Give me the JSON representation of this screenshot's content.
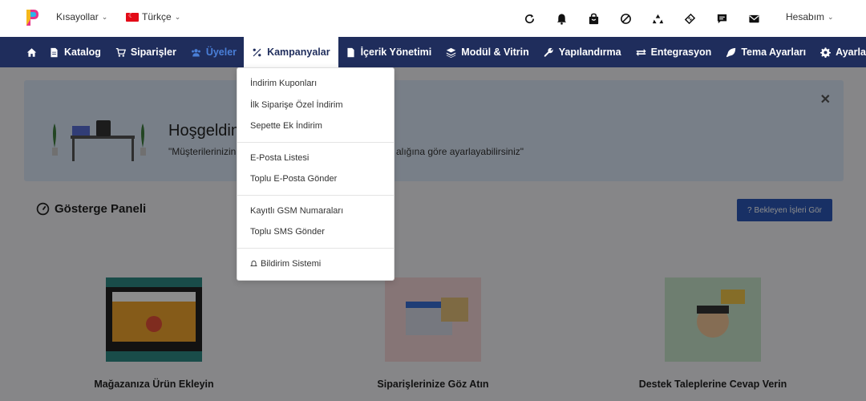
{
  "topbar": {
    "shortcuts_label": "Kısayollar",
    "language_label": "Türkçe",
    "account_label": "Hesabım",
    "icons": [
      "refresh-icon",
      "bell-icon",
      "shopping-bag-icon",
      "block-icon",
      "recycle-icon",
      "ticket-icon",
      "chat-icon",
      "mail-icon"
    ]
  },
  "nav": {
    "items": [
      {
        "label": "",
        "icon": "home-icon"
      },
      {
        "label": "Katalog",
        "icon": "file-icon"
      },
      {
        "label": "Siparişler",
        "icon": "cart-icon"
      },
      {
        "label": "Üyeler",
        "icon": "users-icon"
      },
      {
        "label": "Kampanyalar",
        "icon": "percent-icon"
      },
      {
        "label": "İçerik Yönetimi",
        "icon": "page-icon"
      },
      {
        "label": "Modül & Vitrin",
        "icon": "layers-icon"
      },
      {
        "label": "Yapılandırma",
        "icon": "wrench-icon"
      },
      {
        "label": "Entegrasyon",
        "icon": "exchange-icon"
      },
      {
        "label": "Tema Ayarları",
        "icon": "leaf-icon"
      },
      {
        "label": "Ayarlar",
        "icon": "gear-icon"
      }
    ]
  },
  "dropdown": {
    "items": [
      "İndirim Kuponları",
      "İlk Siparişe Özel İndirim",
      "Sepette Ek İndirim",
      "E-Posta Listesi",
      "Toplu E-Posta Gönder",
      "Kayıtlı GSM Numaraları",
      "Toplu SMS Gönder",
      "Bildirim Sistemi"
    ]
  },
  "welcome": {
    "title": "Hoşgeldin",
    "text": "\"Müşterilerinizin",
    "text_tail": "alığına göre ayarlayabilirsiniz\""
  },
  "dashboard": {
    "title": "Gösterge Paneli",
    "pending_button": "Bekleyen İşleri Gör"
  },
  "cards": [
    {
      "title": "Mağazanıza Ürün Ekleyin"
    },
    {
      "title": "Siparişlerinize Göz Atın"
    },
    {
      "title": "Destek Taleplerine Cevap Verin"
    }
  ]
}
